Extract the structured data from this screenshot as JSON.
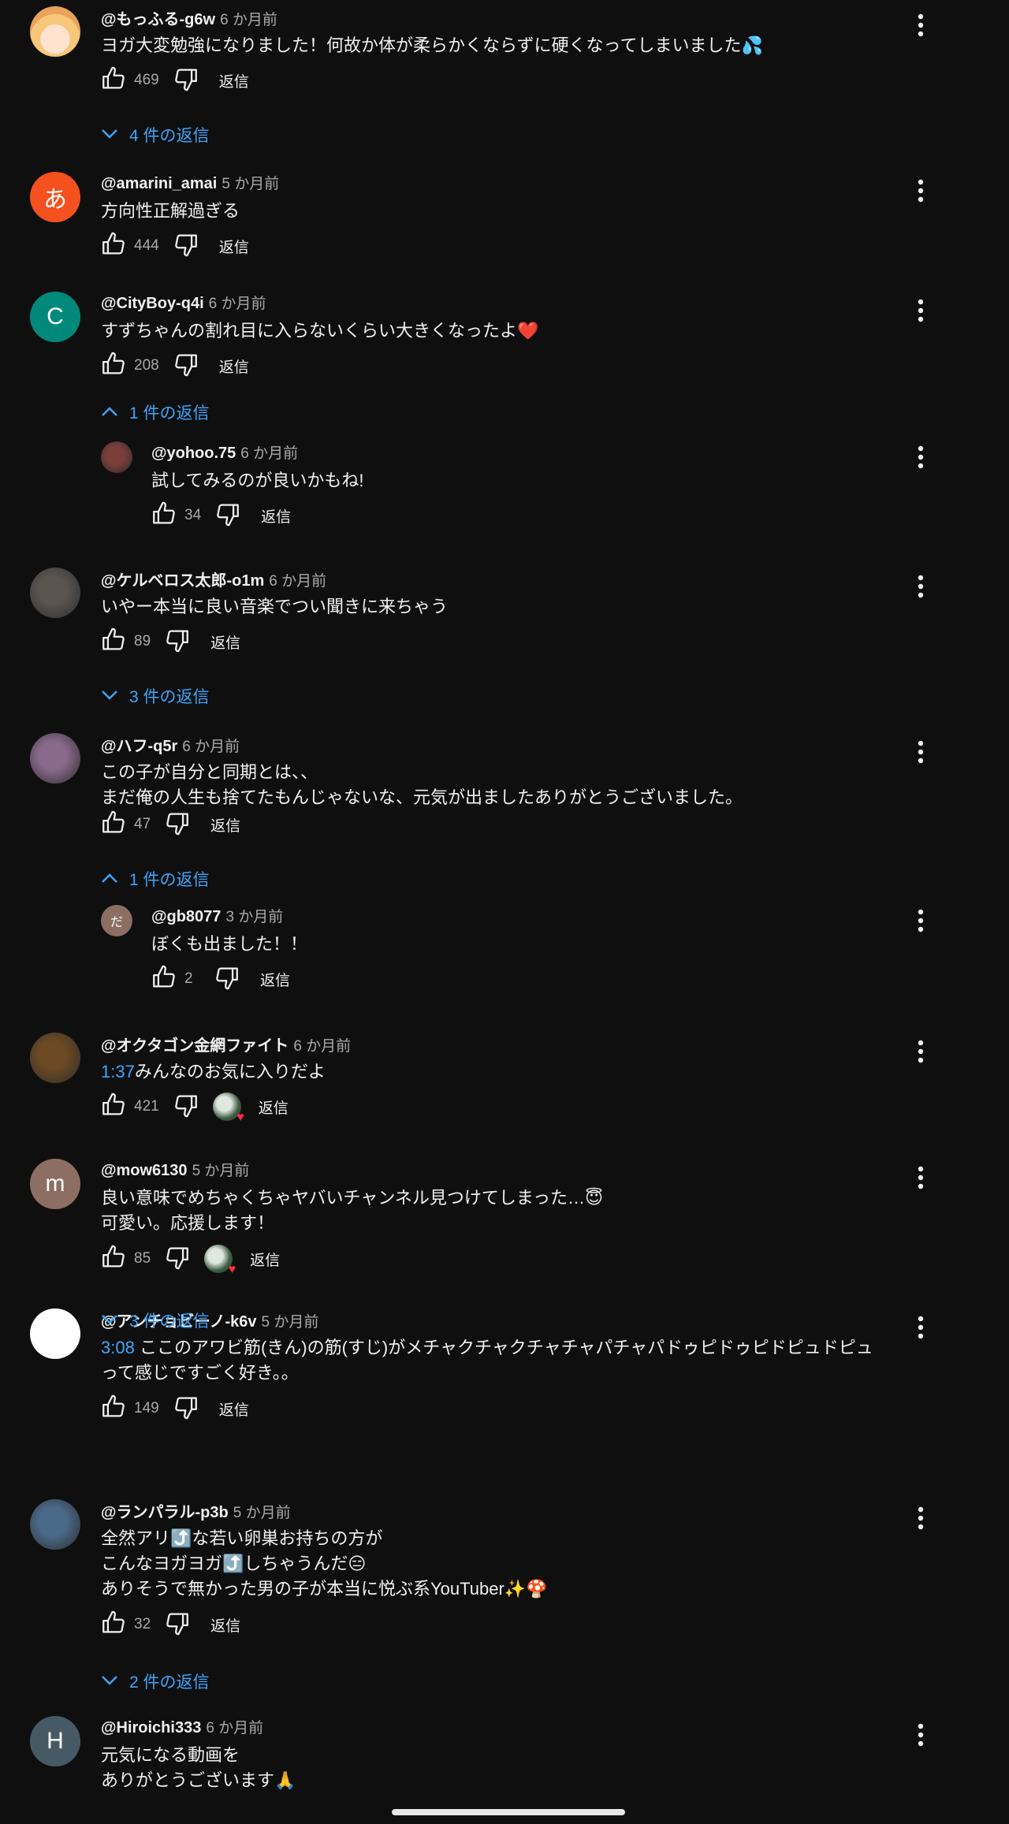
{
  "colors": {
    "background": "#0f0f0f",
    "text": "#f1f1f1",
    "secondary": "#aaaaaa",
    "link": "#3ea6ff",
    "heart": "#ff2b3a"
  },
  "labels": {
    "reply": "返信"
  },
  "comments": [
    {
      "author": "@もっふる-g6w",
      "time": "6 か月前",
      "lines": [
        "ヨガ大変勉強になりました！何故か体が柔らかくならずに硬くなってしまいました💦"
      ],
      "likes": "469",
      "avatar": {
        "type": "anime",
        "color": "#f2c9a0"
      },
      "toggle": "4 件の返信",
      "toggle_open": false
    },
    {
      "author": "@amarini_amai",
      "time": "5 か月前",
      "lines": [
        "方向性正解過ぎる"
      ],
      "likes": "444",
      "avatar": {
        "type": "letter",
        "letter": "あ",
        "color": "#f4511e"
      }
    },
    {
      "author": "@CityBoy-q4i",
      "time": "6 か月前",
      "lines": [
        "すずちゃんの割れ目に入らないくらい大きくなったよ❤️"
      ],
      "likes": "208",
      "avatar": {
        "type": "letter",
        "letter": "C",
        "color": "#00897b"
      },
      "toggle": "1 件の返信",
      "toggle_open": true,
      "reply": {
        "author": "@yohoo.75",
        "time": "6 か月前",
        "text": "試してみるのが良いかもね!",
        "likes": "34",
        "avatar": {
          "type": "photo",
          "color": "#7a3f3a"
        }
      }
    },
    {
      "author": "@ケルベロス太郎-o1m",
      "time": "6 か月前",
      "lines": [
        "いやー本当に良い音楽でつい聞きに来ちゃう"
      ],
      "likes": "89",
      "avatar": {
        "type": "photo",
        "color": "#5b5550"
      },
      "toggle": "3 件の返信",
      "toggle_open": false
    },
    {
      "author": "@ハフ-q5r",
      "time": "6 か月前",
      "lines": [
        "この子が自分と同期とは、、",
        "まだ俺の人生も捨てたもんじゃないな、元気が出ましたありがとうございました。"
      ],
      "likes": "47",
      "avatar": {
        "type": "photo",
        "color": "#8a6a8c"
      },
      "toggle": "1 件の返信",
      "toggle_open": true,
      "reply": {
        "author": "@gb8077",
        "time": "3 か月前",
        "text": "ぼくも出ました！！",
        "likes": "2",
        "avatar": {
          "type": "letter",
          "letter": "だ",
          "color": "#8d6e63"
        }
      }
    },
    {
      "author": "@オクタゴン金網ファイト",
      "time": "6 か月前",
      "timestamp": "1:37",
      "lines": [
        "みんなのお気に入りだよ"
      ],
      "likes": "421",
      "avatar": {
        "type": "photo",
        "color": "#6b4a24"
      },
      "hearted": true
    },
    {
      "author": "@mow6130",
      "time": "5 か月前",
      "lines": [
        "良い意味でめちゃくちゃヤバいチャンネル見つけてしまった…😇",
        "可愛い。応援します！"
      ],
      "likes": "85",
      "avatar": {
        "type": "letter",
        "letter": "m",
        "color": "#8d6e63"
      },
      "hearted": true
    },
    {
      "author": "@アンチョビーノ-k6v",
      "time": "5 か月前",
      "timestamp": "3:08",
      "lines": [
        " ここのアワビ筋(きん)の筋(すじ)がメチャクチャクチャチャパチャパドゥピドゥピドピュドピュ",
        "って感じですごく好き。。"
      ],
      "likes": "149",
      "avatar": {
        "type": "white",
        "color": "#ffffff"
      },
      "toggle": "3 件の返信",
      "toggle_open": false
    },
    {
      "author": "@ランパラル-p3b",
      "time": "5 か月前",
      "lines": [
        "全然アリ⤴️な若い卵巣お持ちの方が",
        "こんなヨガヨガ⤴️しちゃうんだ😑",
        "ありそうで無かった男の子が本当に悦ぶ系YouTuber✨🍄"
      ],
      "likes": "32",
      "avatar": {
        "type": "photo",
        "color": "#4a6a8a"
      },
      "toggle": "2 件の返信",
      "toggle_open": false
    },
    {
      "author": "@Hiroichi333",
      "time": "6 か月前",
      "lines": [
        "元気になる動画を",
        "ありがとうございます🙏"
      ],
      "avatar": {
        "type": "letter",
        "letter": "H",
        "color": "#455a64"
      }
    }
  ]
}
